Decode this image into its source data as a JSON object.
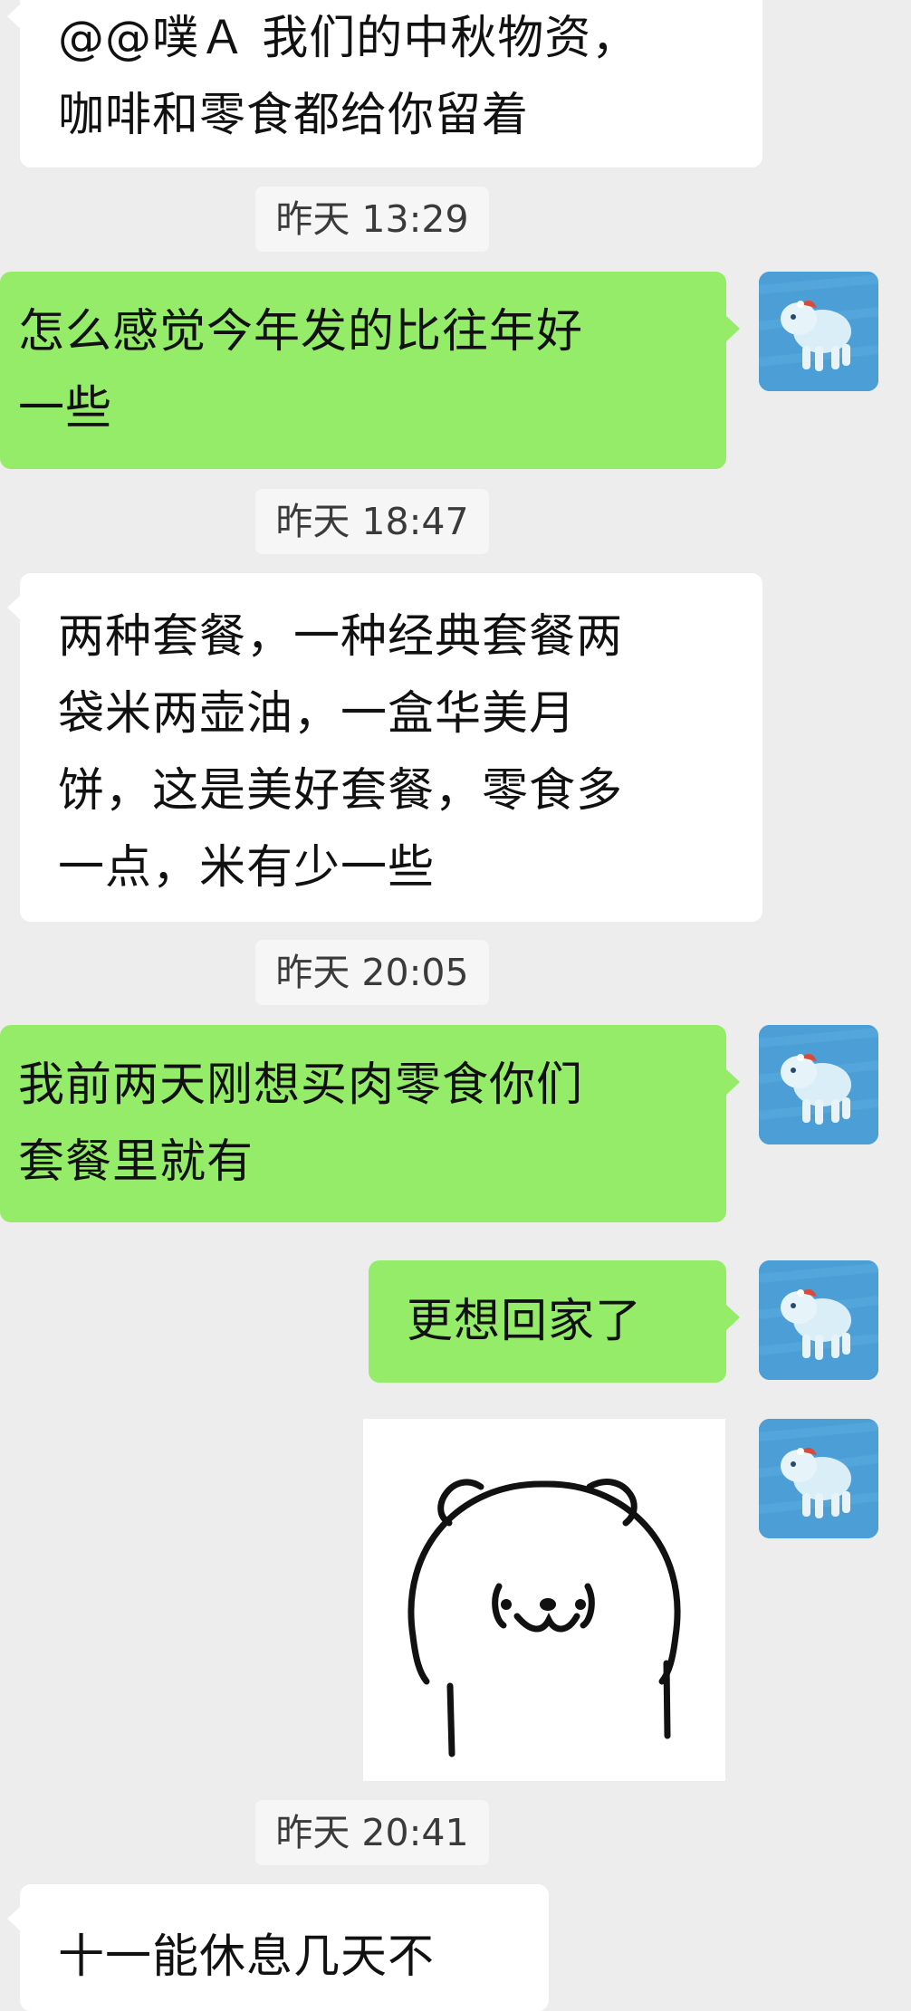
{
  "messages": [
    {
      "sender": "other",
      "lines": [
        "@@噗Ａ 我们的中秋物资，",
        "咖啡和零食都给你留着"
      ]
    },
    {
      "time": "昨天 13:29"
    },
    {
      "sender": "me",
      "lines": [
        "怎么感觉今年发的比往年好",
        "一些"
      ]
    },
    {
      "time": "昨天 18:47"
    },
    {
      "sender": "other",
      "lines": [
        "两种套餐，一种经典套餐两",
        "袋米两壶油，一盒华美月",
        "饼，这是美好套餐，零食多",
        "一点，米有少一些"
      ]
    },
    {
      "time": "昨天 20:05"
    },
    {
      "sender": "me",
      "lines": [
        "我前两天刚想买肉零食你们",
        "套餐里就有"
      ]
    },
    {
      "sender": "me",
      "lines": [
        "更想回家了"
      ]
    },
    {
      "sender": "me",
      "type": "sticker",
      "sticker_icon": "bear-sticker-icon"
    },
    {
      "time": "昨天 20:41"
    },
    {
      "sender": "other",
      "lines": [
        "十一能休息几天不"
      ]
    }
  ],
  "avatar_icon": "blue-dog-avatar-icon",
  "colors": {
    "background": "#ededed",
    "incoming_bubble": "#ffffff",
    "outgoing_bubble": "#95ec69",
    "timestamp_bg": "#f6f6f6",
    "avatar_bg": "#4b9fd6"
  }
}
